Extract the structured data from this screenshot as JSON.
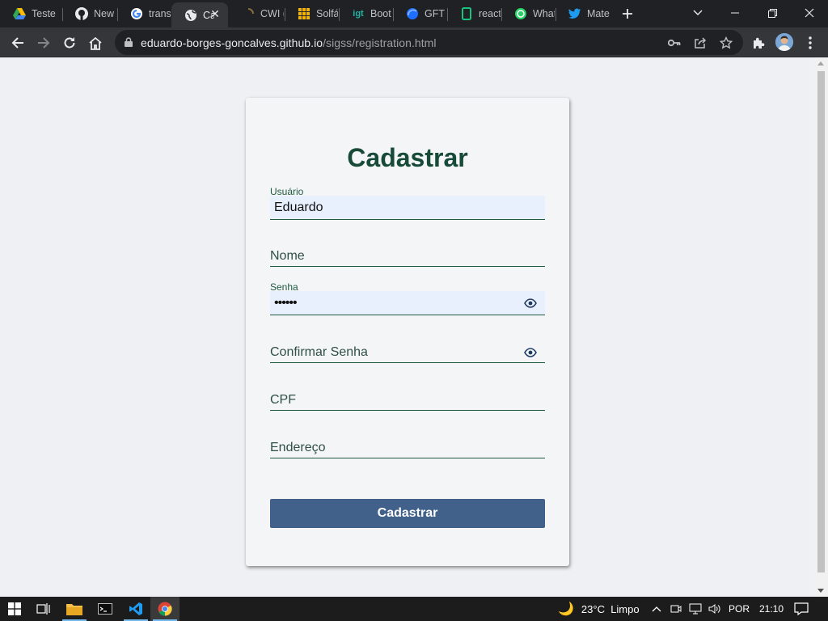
{
  "browser": {
    "tabs": [
      {
        "title": "Teste",
        "icon": "google-drive-icon"
      },
      {
        "title": "New",
        "icon": "github-icon"
      },
      {
        "title": "trans",
        "icon": "google-icon"
      },
      {
        "title": "Ca",
        "icon": "globe-icon",
        "active": true
      },
      {
        "title": "CWI (",
        "icon": "loading-icon"
      },
      {
        "title": "Solfá",
        "icon": "grid-app-icon"
      },
      {
        "title": "Boot",
        "icon": "gt-icon"
      },
      {
        "title": "GFT S",
        "icon": "gft-icon"
      },
      {
        "title": "react",
        "icon": "phone-frame-icon"
      },
      {
        "title": "What",
        "icon": "whatsapp-icon"
      },
      {
        "title": "Mate",
        "icon": "twitter-icon"
      }
    ],
    "url_host": "eduardo-borges-goncalves.github.io",
    "url_path": "/sigss/registration.html"
  },
  "form": {
    "title": "Cadastrar",
    "usuario_label": "Usuário",
    "usuario_value": "Eduardo",
    "nome_placeholder": "Nome",
    "senha_label": "Senha",
    "senha_value": "••••••",
    "confirmar_placeholder": "Confirmar Senha",
    "cpf_placeholder": "CPF",
    "endereco_placeholder": "Endereço",
    "submit_label": "Cadastrar"
  },
  "taskbar": {
    "weather": "23°C  Limpo",
    "language": "POR",
    "time": "21:10"
  },
  "colors": {
    "title_green": "#184a38",
    "button_blue": "#41608a",
    "autofill_bg": "#e8f0fe"
  }
}
